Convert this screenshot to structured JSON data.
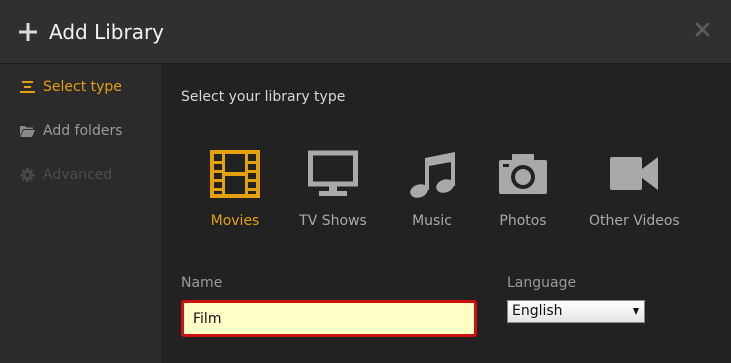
{
  "header": {
    "title": "Add Library"
  },
  "sidebar": {
    "items": [
      {
        "label": "Select type",
        "icon": "list-icon",
        "state": "active"
      },
      {
        "label": "Add folders",
        "icon": "folder-icon",
        "state": "normal"
      },
      {
        "label": "Advanced",
        "icon": "gear-icon",
        "state": "disabled"
      }
    ]
  },
  "main": {
    "section_title": "Select your library type",
    "types": [
      {
        "label": "Movies",
        "icon": "film-icon",
        "selected": true
      },
      {
        "label": "TV Shows",
        "icon": "tv-icon",
        "selected": false
      },
      {
        "label": "Music",
        "icon": "music-note-icon",
        "selected": false
      },
      {
        "label": "Photos",
        "icon": "camera-icon",
        "selected": false
      },
      {
        "label": "Other Videos",
        "icon": "video-camera-icon",
        "selected": false
      }
    ],
    "name_label": "Name",
    "name_value": "Film",
    "language_label": "Language",
    "language_value": "English"
  },
  "colors": {
    "accent": "#e5a00d",
    "input_error_border": "#cc1111",
    "input_background": "#ffffc6"
  }
}
